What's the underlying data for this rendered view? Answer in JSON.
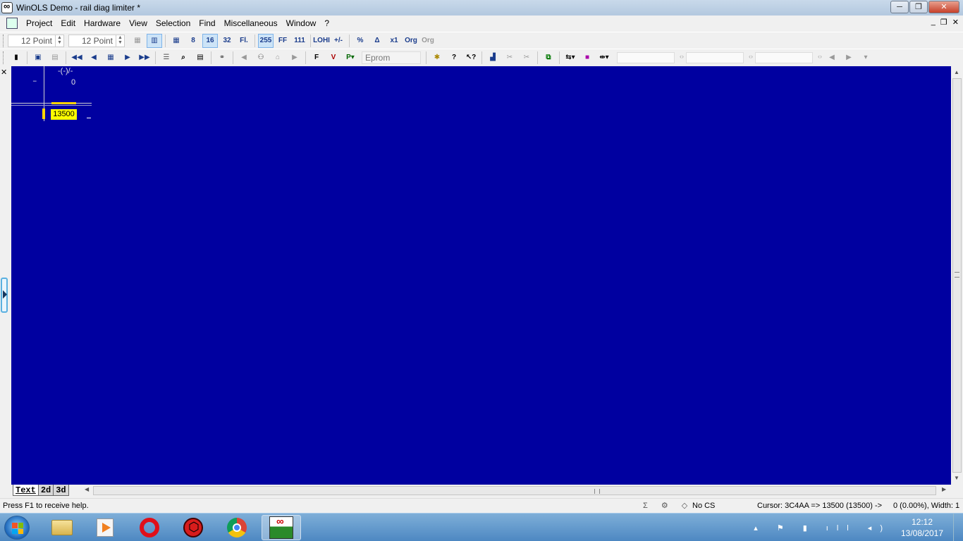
{
  "window": {
    "title": "WinOLS Demo - rail diag limiter *",
    "minimize": "─",
    "maximize": "❐",
    "close": "✕"
  },
  "menu": {
    "items": [
      "Project",
      "Edit",
      "Hardware",
      "View",
      "Selection",
      "Find",
      "Miscellaneous",
      "Window",
      "?"
    ],
    "mdi_minimize": "_",
    "mdi_restore": "❐",
    "mdi_close": "✕"
  },
  "toolbar1": {
    "font_size_1": "12 Point",
    "font_size_2": "12 Point",
    "buttons": [
      "8",
      "16",
      "32",
      "Fl.",
      "255",
      "FF",
      "111",
      "LOHI",
      "+/-",
      "%",
      "Δ",
      "x1",
      "Org",
      "Org"
    ]
  },
  "toolbar2": {
    "eprom_label": "Eprom"
  },
  "editor": {
    "column_header": "-(-)/-",
    "row_header": "–",
    "column_value": "0",
    "selected_cell_value": "13500",
    "background_color": "#0000a0",
    "highlight_color": "#ffff00"
  },
  "tabs": [
    "Text",
    "2d",
    "3d"
  ],
  "statusbar": {
    "help": "Press F1 to receive help.",
    "icons": "Σ ⚙ ◇",
    "checksum": "No CS",
    "cursor": "Cursor: 3C4AA => 13500 (13500) ->",
    "width_info": "0 (0.00%), Width: 1"
  },
  "taskbar": {
    "apps": [
      "file-explorer",
      "media-player",
      "opera",
      "red-app",
      "chrome",
      "winols"
    ],
    "tray_icons": "▴ ⚑ ▮ ıll ◂)",
    "time": "12:12",
    "date": "13/08/2017"
  }
}
